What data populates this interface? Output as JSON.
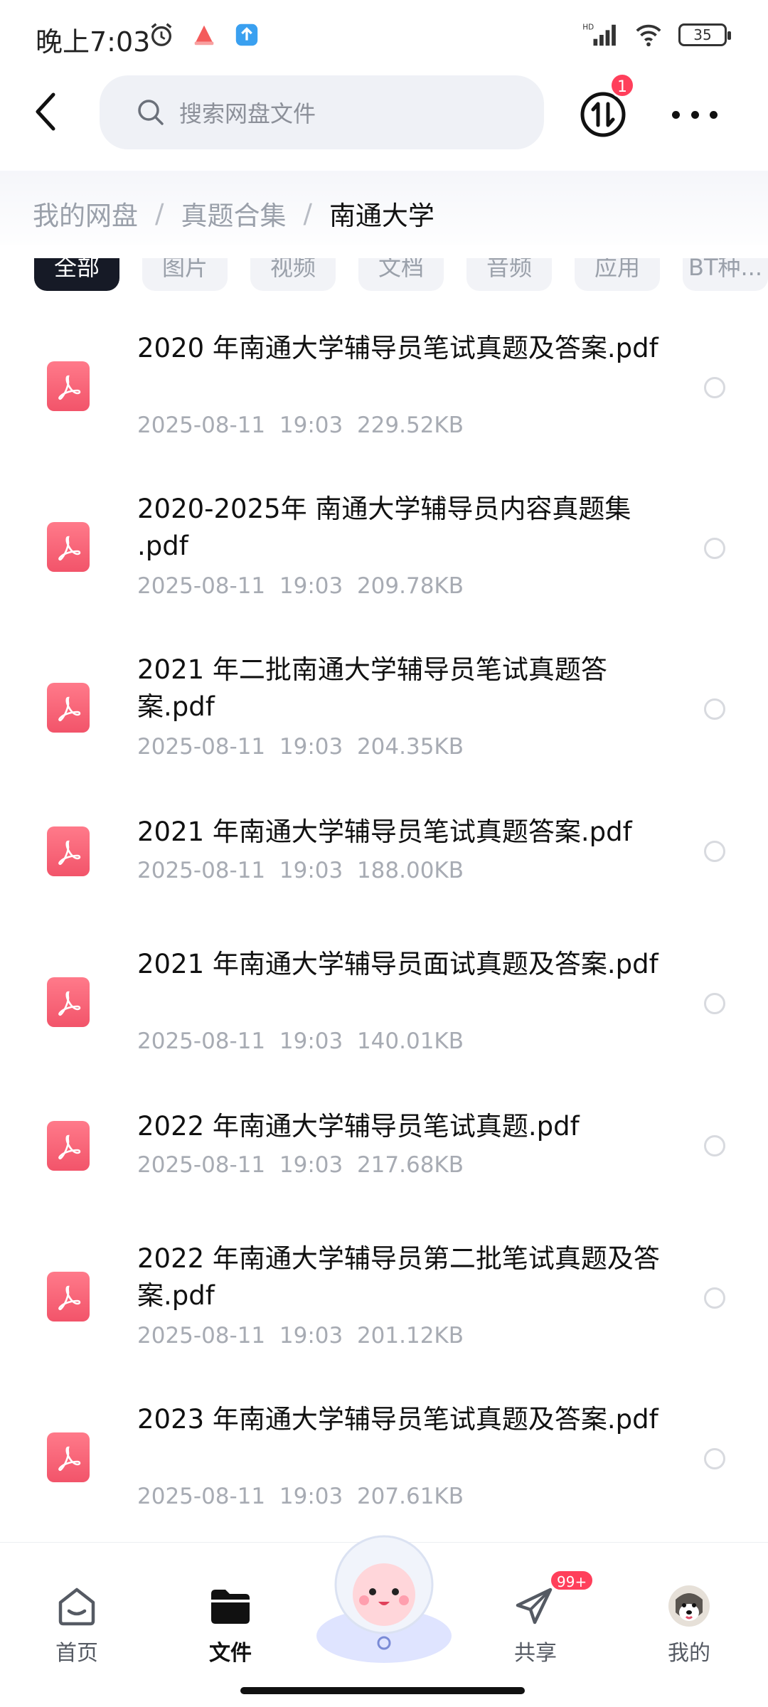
{
  "status_bar": {
    "time": "晚上7:03",
    "battery": "35",
    "icons_left": [
      "alarm-icon",
      "app-notification-icon",
      "upload-notification-icon"
    ],
    "icons_right": [
      "hd-signal-icon",
      "wifi-icon",
      "battery-icon"
    ]
  },
  "header": {
    "search_placeholder": "搜索网盘文件",
    "transfer_badge": "1"
  },
  "breadcrumb": {
    "items": [
      "我的网盘",
      "真题合集",
      "南通大学"
    ],
    "separator": "/"
  },
  "filters": {
    "items": [
      "全部",
      "图片",
      "视频",
      "文档",
      "音频",
      "应用",
      "BT种..."
    ],
    "active": "全部"
  },
  "files": [
    {
      "name": "2020 年南通大学辅导员笔试真题及答案.pdf",
      "date": "2025-08-11",
      "time": "19:03",
      "size": "229.52KB"
    },
    {
      "name": "2020-2025年 南通大学辅导员内容真题集 .pdf",
      "date": "2025-08-11",
      "time": "19:03",
      "size": "209.78KB"
    },
    {
      "name": "2021 年二批南通大学辅导员笔试真题答案.pdf",
      "date": "2025-08-11",
      "time": "19:03",
      "size": "204.35KB"
    },
    {
      "name": "2021 年南通大学辅导员笔试真题答案.pdf",
      "date": "2025-08-11",
      "time": "19:03",
      "size": "188.00KB"
    },
    {
      "name": "2021 年南通大学辅导员面试真题及答案.pdf",
      "date": "2025-08-11",
      "time": "19:03",
      "size": "140.01KB"
    },
    {
      "name": "2022 年南通大学辅导员笔试真题.pdf",
      "date": "2025-08-11",
      "time": "19:03",
      "size": "217.68KB"
    },
    {
      "name": "2022 年南通大学辅导员第二批笔试真题及答案.pdf",
      "date": "2025-08-11",
      "time": "19:03",
      "size": "201.12KB"
    },
    {
      "name": "2023 年南通大学辅导员笔试真题及答案.pdf",
      "date": "2025-08-11",
      "time": "19:03",
      "size": "207.61KB"
    }
  ],
  "bottom_nav": {
    "items": [
      {
        "label": "首页",
        "icon": "home-icon"
      },
      {
        "label": "文件",
        "icon": "folder-icon"
      },
      {
        "label": "共享",
        "icon": "paper-plane-icon"
      },
      {
        "label": "我的",
        "icon": "avatar"
      }
    ],
    "active": "文件",
    "share_badge": "99+"
  },
  "colors": {
    "accent_dark": "#161a26",
    "badge_red": "#ff3f5b",
    "pdf_red": "#f2546a",
    "meta_gray": "#a7abb3"
  }
}
